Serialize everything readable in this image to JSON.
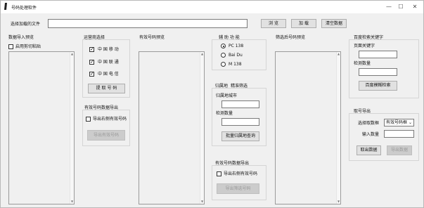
{
  "window": {
    "title": "号码处理软件",
    "controls": {
      "minimize": "—",
      "maximize": "☐",
      "close": "✕"
    }
  },
  "top": {
    "file_label": "选择加载的文件",
    "file_value": "",
    "browse": "浏 览",
    "load": "加 载",
    "clear": "清空数据"
  },
  "import_preview": {
    "title": "数据导入预览",
    "clipboard": "启用剪切粘贴",
    "clipboard_checked": false
  },
  "carrier": {
    "title": "运营商选择",
    "items": [
      {
        "label": "中 国 移 动",
        "checked": true
      },
      {
        "label": "中 国 联 通",
        "checked": true
      },
      {
        "label": "中 国 电 信",
        "checked": true
      }
    ],
    "extract": "提 取 号 码"
  },
  "valid_export": {
    "title": "有效号码数据导出",
    "check": "导出右侧有效号码",
    "check_checked": false,
    "button": "导出有效号码"
  },
  "valid_preview": {
    "title": "有效号码预览"
  },
  "aux": {
    "title": "辅 助 功 能",
    "options": [
      {
        "label": "PC 138",
        "selected": true
      },
      {
        "label": "Bai Du",
        "selected": false
      },
      {
        "label": "M 138",
        "selected": false
      }
    ]
  },
  "location": {
    "tabs": [
      "归属地",
      "精准筛选"
    ],
    "city_label": "归属地城市",
    "city_value": "",
    "count_label": "检测数量",
    "count_value": "",
    "query": "批量归属地查询"
  },
  "filter_export": {
    "title": "有效号码数据导出",
    "check": "导出右侧有效号码",
    "check_checked": false,
    "button": "导出筛选号码"
  },
  "filtered_preview": {
    "title": "筛选后号码预览"
  },
  "baidu": {
    "title": "百度检索关键字",
    "keyword_label": "页面关键字",
    "keyword_value": "",
    "count_label": "检测数量",
    "count_value": "",
    "button": "百度模糊检索"
  },
  "number_export": {
    "title": "取号导出",
    "source_label": "选择取数框",
    "source_value": "有效号码框",
    "qty_label": "输入数量",
    "qty_value": "",
    "take": "取出数据",
    "export": "导出数据"
  }
}
